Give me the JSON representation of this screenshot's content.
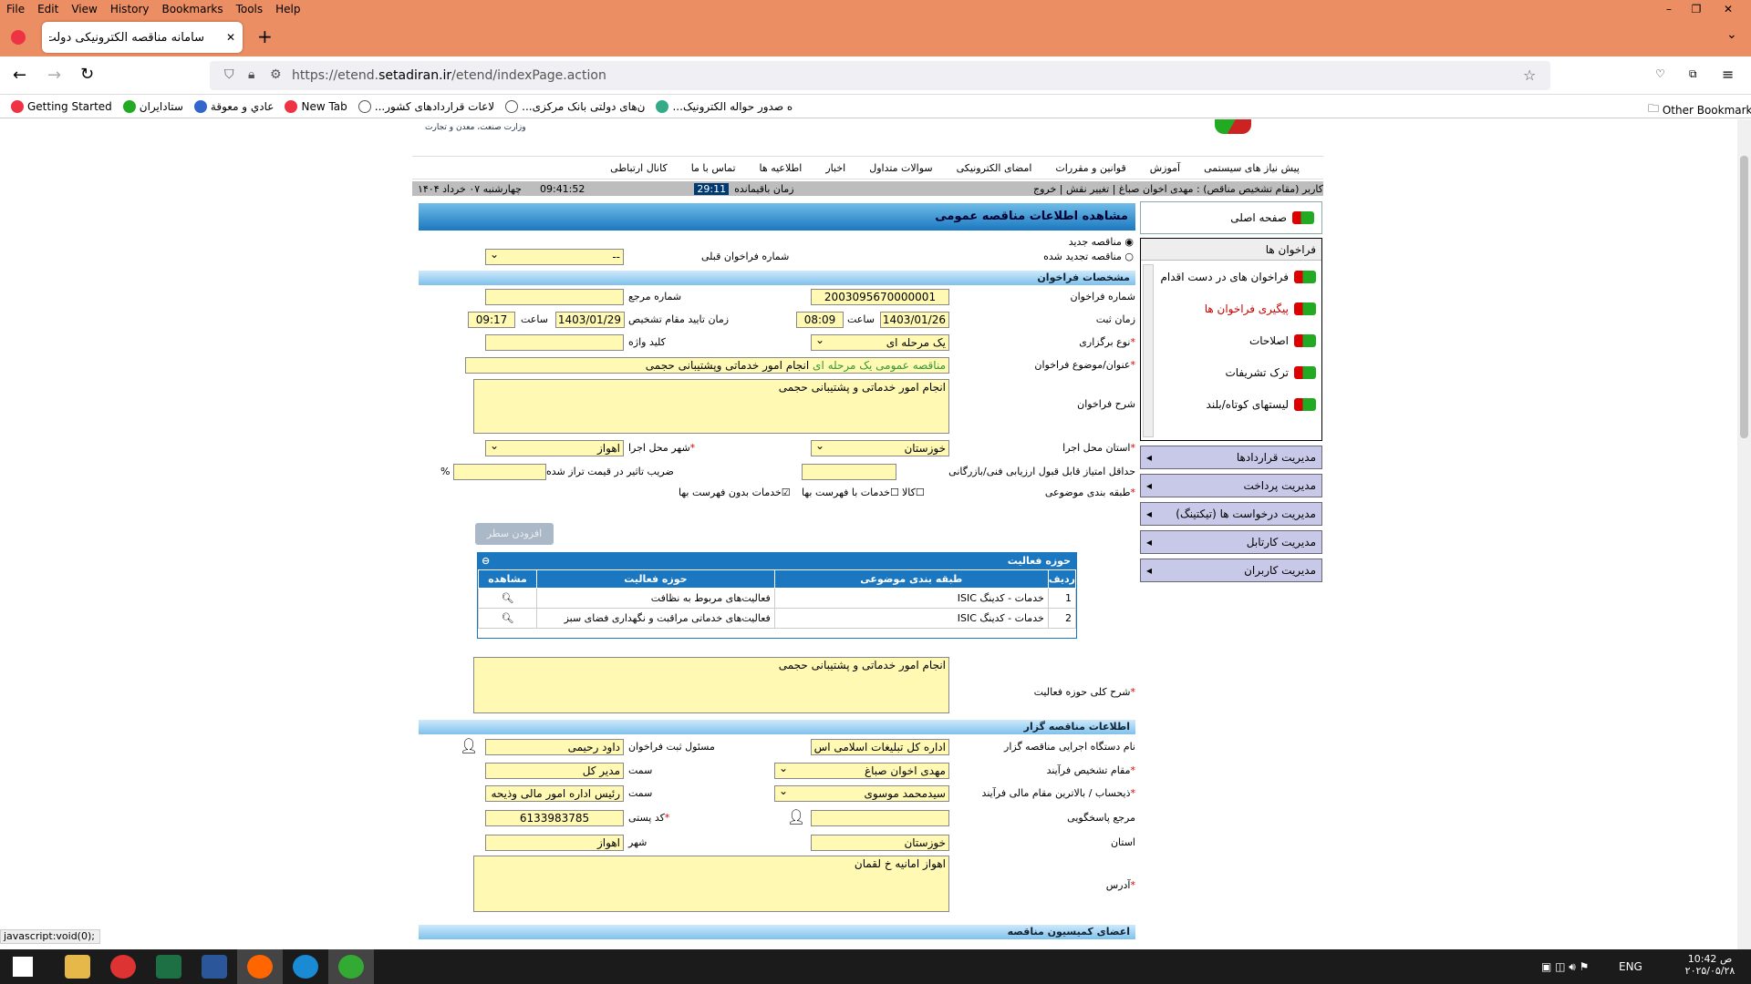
{
  "browser": {
    "menu": [
      "File",
      "Edit",
      "View",
      "History",
      "Bookmarks",
      "Tools",
      "Help"
    ],
    "tab_title": "سامانه مناقصه الکترونیکی دولت",
    "url_prefix": "https://etend.",
    "url_domain": "setadiran.ir",
    "url_path": "/etend/indexPage.action",
    "bookmarks": [
      "Getting Started",
      "ستادایران",
      "عادي و معوقة",
      "New Tab",
      "...لاعات قراردادهای کشور",
      "...ن‌های دولتی بانک مرکزی",
      "...ه صدور حواله الکترونیک"
    ],
    "other_bookmarks": "Other Bookmarks",
    "status_url": "javascript:void(0);"
  },
  "site": {
    "header_text": "وزارت صنعت، معدن و تجارت",
    "topnav": [
      "پیش نیاز های سیستمی",
      "آموزش",
      "قوانین و مقررات",
      "امضای الکترونیکی",
      "سوالات متداول",
      "اخبار",
      "اطلاعیه ها",
      "تماس با ما",
      "کانال ارتباطی"
    ],
    "userbar_user": "کاربر (مقام تشخیص مناقص) : مهدی اخوان صباغ | تغییر نقش | خروج",
    "remaining_label": "زمان باقیمانده",
    "remaining_value": "29:11",
    "clock": "09:41:52",
    "date": "چهارشنبه ۰۷ خرداد ۱۴۰۴"
  },
  "sidebar": {
    "home": "صفحه اصلی",
    "calls_header": "فراخوان ها",
    "calls_items": [
      "فراخوان های در دست اقدام",
      "پیگیری فراخوان ها",
      "اصلاحات",
      "ترک تشریفات",
      "لیستهای کوتاه/بلند"
    ],
    "managers": [
      "مدیریت قراردادها",
      "مدیریت پرداخت",
      "مدیریت درخواست ها (تیکتینگ)",
      "مدیریت کارتابل",
      "مدیریت کاربران"
    ]
  },
  "form": {
    "title": "مشاهده اطلاعات مناقصه عمومی",
    "radio_new": "مناقصه جدید",
    "radio_renewed": "مناقصه تجدید شده",
    "prev_call_label": "شماره فراخوان قبلی",
    "prev_call_value": "--",
    "sec_spec": "مشخصات فراخوان",
    "call_no_label": "شماره فراخوان",
    "call_no": "2003095670000001",
    "ref_no_label": "شماره مرجع",
    "reg_time_label": "زمان ثبت",
    "reg_date": "1403/01/26",
    "hour_label": "ساعت",
    "reg_hour": "08:09",
    "approve_label": "زمان تایید مقام تشخیص",
    "approve_date": "1403/01/29",
    "approve_hour": "09:17",
    "type_label": "نوع برگزاری",
    "type_value": "یک مرحله ای",
    "keyword_label": "کلید واژه",
    "subject_label": "عنوان/موضوع فراخوان",
    "subject_prefix": "مناقصه عمومی یک مرحله ای",
    "subject_value": "انجام امور خدماتی وپشتیبانی حجمی",
    "desc_label": "شرح فراخوان",
    "desc_value": "انجام امور خدماتی و پشتیبانی حجمی",
    "province_label": "استان محل اجرا",
    "province_value": "خوزستان",
    "city_label": "شهر محل اجرا",
    "city_value": "اهواز",
    "min_score_label": "حداقل امتیاز قابل قبول ارزیابی فنی/بازرگانی",
    "coef_label": "ضریب تاثیر در قیمت تراز شده",
    "percent": "%",
    "class_label": "طبقه بندی موضوعی",
    "opt_goods": "کالا",
    "opt_services_list": "خدمات با فهرست بها",
    "opt_services_nolist": "خدمات بدون فهرست بها",
    "add_row": "افزودن سطر",
    "activity_title": "حوزه فعالیت",
    "cols": [
      "ردیف",
      "طبقه بندی موضوعی",
      "حوزه فعالیت",
      "مشاهده"
    ],
    "rows": [
      [
        "1",
        "خدمات - کدینگ ISIC",
        "فعالیت‌های مربوط به نظافت"
      ],
      [
        "2",
        "خدمات - کدینگ ISIC",
        "فعالیت‌های خدماتی مراقبت و نگهداری فضای سبز"
      ]
    ],
    "activity_desc_label": "شرح کلی حوزه فعالیت",
    "activity_desc": "انجام امور خدماتی و پشتیبانی حجمی",
    "sec_org": "اطلاعات مناقصه گزار",
    "org_label": "نام دستگاه اجرایی مناقصه گزار",
    "org_value": "اداره کل تبلیغات اسلامی اس",
    "registrar_label": "مسئول ثبت فراخوان",
    "registrar_value": "داود رحیمی",
    "authority_label": "مقام تشخیص فرآیند",
    "authority_value": "مهدی اخوان صباغ",
    "position_label": "سمت",
    "position1": "مدیر کل",
    "finance_label": "ذیحساب / بالاترین مقام مالی فرآیند",
    "finance_value": "سیدمحمد موسوی",
    "position2": "رئیس اداره امور مالی وذیحه",
    "responder_label": "مرجع پاسخگویی",
    "postal_label": "کد پستی",
    "postal_value": "6133983785",
    "state_label": "استان",
    "state_value": "خوزستان",
    "town_label": "شهر",
    "town_value": "اهواز",
    "address_label": "آدرس",
    "address_value": "اهواز امانیه خ لقمان",
    "sec_commission": "اعضای کمیسیون مناقصه"
  },
  "taskbar": {
    "lang": "ENG",
    "time": "10:42 ص",
    "date": "۲۰۲۵/۰۵/۲۸"
  }
}
